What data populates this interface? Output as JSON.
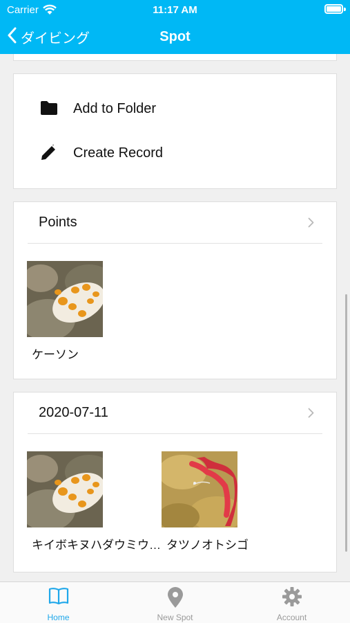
{
  "status_bar": {
    "carrier": "Carrier",
    "time": "11:17 AM"
  },
  "nav": {
    "back_label": "ダイビング",
    "title": "Spot"
  },
  "actions": [
    {
      "label": "Add to Folder",
      "icon": "folder-icon"
    },
    {
      "label": "Create Record",
      "icon": "pencil-icon"
    }
  ],
  "points": {
    "title": "Points",
    "items": [
      {
        "label": "ケーソン",
        "image": "nudibranch-photo"
      }
    ]
  },
  "record": {
    "title": "2020-07-11",
    "items": [
      {
        "label": "キイボキヌハダウミウ…",
        "image": "nudibranch-photo"
      },
      {
        "label": "タツノオトシゴ",
        "image": "seahorse-photo"
      }
    ]
  },
  "tabs": [
    {
      "label": "Home",
      "icon": "book-icon",
      "active": true
    },
    {
      "label": "New Spot",
      "icon": "location-pin-icon",
      "active": false
    },
    {
      "label": "Account",
      "icon": "gear-icon",
      "active": false
    }
  ],
  "colors": {
    "accent": "#00b8f5",
    "tab_active": "#1ea7ea",
    "tab_inactive": "#9a9a9a"
  }
}
